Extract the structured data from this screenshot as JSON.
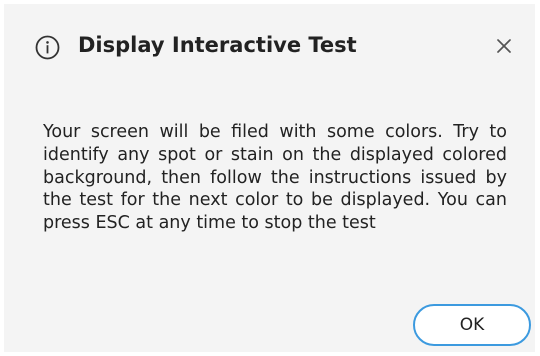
{
  "dialog": {
    "title": "Display Interactive Test",
    "icon": "info-icon",
    "close_icon": "close-icon",
    "message": "Your screen will be filed with some colors. Try to identify any spot or stain on the displayed colored background, then follow the instructions issued by the test for the next color to be displayed. You can press ESC at any time to stop the test",
    "ok_label": "OK"
  },
  "colors": {
    "dialog_background": "#f4f4f4",
    "ok_border": "#3c9adf",
    "text": "#222222"
  }
}
